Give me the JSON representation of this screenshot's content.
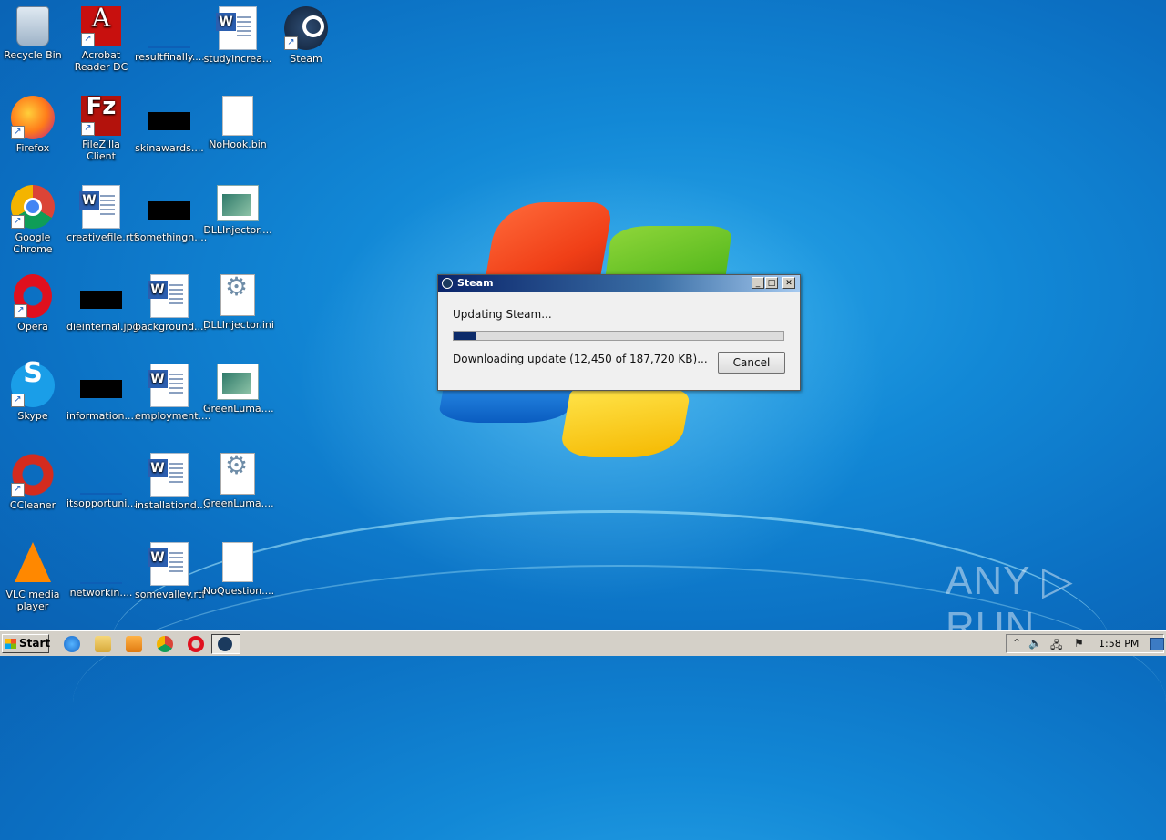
{
  "desktop": {
    "icons": [
      {
        "label": "Recycle Bin"
      },
      {
        "label": "Acrobat Reader DC"
      },
      {
        "label": "resultfinally...."
      },
      {
        "label": "studyincrea..."
      },
      {
        "label": "Steam"
      },
      {
        "label": "Firefox"
      },
      {
        "label": "FileZilla Client"
      },
      {
        "label": "skinawards...."
      },
      {
        "label": "NoHook.bin"
      },
      {
        "label": "Google Chrome"
      },
      {
        "label": "creativefile.rtf"
      },
      {
        "label": "somethingn...."
      },
      {
        "label": "DLLInjector...."
      },
      {
        "label": "Opera"
      },
      {
        "label": "dieinternal.jpg"
      },
      {
        "label": "background...."
      },
      {
        "label": "DLLInjector.ini"
      },
      {
        "label": "Skype"
      },
      {
        "label": "information...."
      },
      {
        "label": "employment...."
      },
      {
        "label": "GreenLuma...."
      },
      {
        "label": "CCleaner"
      },
      {
        "label": "itsopportuni...."
      },
      {
        "label": "installationd...."
      },
      {
        "label": "GreenLuma...."
      },
      {
        "label": "VLC media player"
      },
      {
        "label": "networkin...."
      },
      {
        "label": "somevalley.rtf"
      },
      {
        "label": "NoQuestion...."
      }
    ]
  },
  "dialog": {
    "title": "Steam",
    "status": "Updating Steam...",
    "progress": 0.066,
    "detail": "Downloading update (12,450 of 187,720 KB)...",
    "cancel_label": "Cancel",
    "minimize_glyph": "_",
    "maximize_glyph": "□",
    "close_glyph": "✕"
  },
  "taskbar": {
    "start_label": "Start",
    "clock": "1:58 PM",
    "tray_glyphs": [
      "⌃",
      "🔈",
      "🖧",
      "⚑"
    ]
  },
  "watermark": {
    "text": "ANY ▷ RUN"
  }
}
